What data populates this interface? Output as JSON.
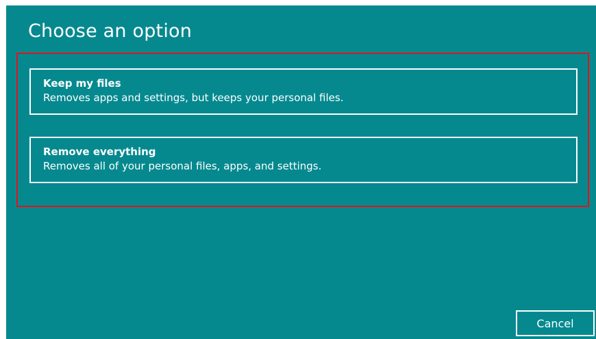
{
  "dialog": {
    "title": "Choose an option"
  },
  "options": [
    {
      "title": "Keep my files",
      "description": "Removes apps and settings, but keeps your personal files."
    },
    {
      "title": "Remove everything",
      "description": "Removes all of your personal files, apps, and settings."
    }
  ],
  "footer": {
    "cancel_label": "Cancel"
  },
  "colors": {
    "background": "#05898f",
    "highlight_border": "#e0141c",
    "text": "#ffffff"
  }
}
